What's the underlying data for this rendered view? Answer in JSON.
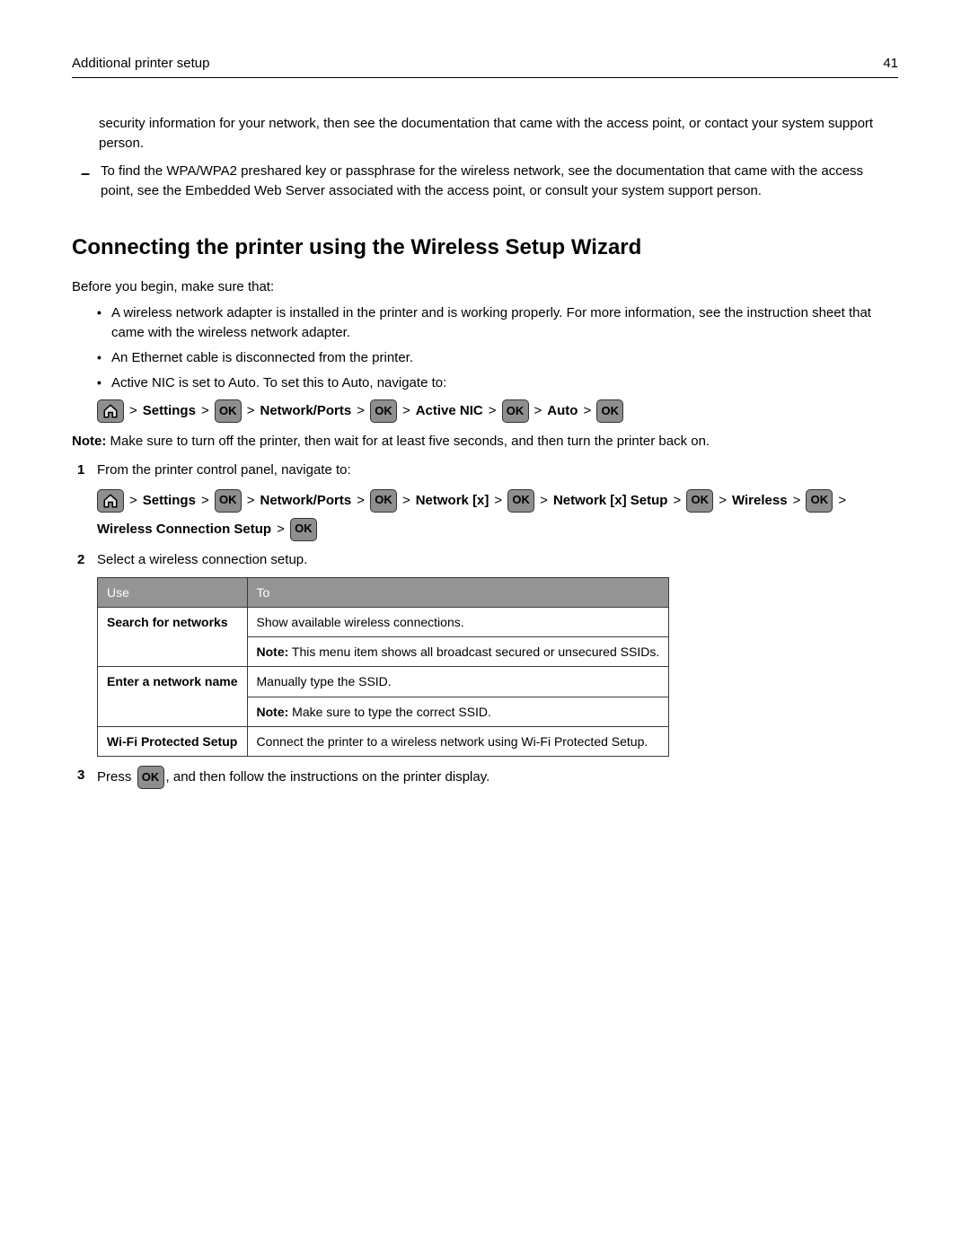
{
  "header": {
    "title": "Additional printer setup",
    "page": "41"
  },
  "continuation_para": "security information for your network, then see the documentation that came with the access point, or contact your system support person.",
  "dash_item": "To find the WPA/WPA2 preshared key or passphrase for the wireless network, see the documentation that came with the access point, see the Embedded Web Server associated with the access point, or consult your system support person.",
  "section_heading": "Connecting the printer using the Wireless Setup Wizard",
  "intro": "Before you begin, make sure that:",
  "bullets": {
    "b1": "A wireless network adapter is installed in the printer and is working properly. For more information, see the instruction sheet that came with the wireless network adapter.",
    "b2": "An Ethernet cable is disconnected from the printer.",
    "b3": "Active NIC is set to Auto. To set this to Auto, navigate to:"
  },
  "nav1": {
    "settings": "Settings",
    "network_ports": "Network/Ports",
    "active_nic": "Active NIC",
    "auto": "Auto",
    "ok": "OK"
  },
  "note_prefix": "Note:",
  "note_text": " Make sure to turn off the printer, then wait for at least five seconds, and then turn the printer back on.",
  "step1_text": "From the printer control panel, navigate to:",
  "nav2": {
    "settings": "Settings",
    "network_ports": "Network/Ports",
    "network_x": "Network [x]",
    "network_x_setup": "Network [x] Setup",
    "wireless": "Wireless",
    "wcs": "Wireless Connection Setup",
    "ok": "OK"
  },
  "step2_text": "Select a wireless connection setup.",
  "table": {
    "h1": "Use",
    "h2": "To",
    "r1c1": "Search for networks",
    "r1c2a": "Show available wireless connections.",
    "r1c2b_prefix": "Note:",
    "r1c2b": " This menu item shows all broadcast secured or unsecured SSIDs.",
    "r2c1": "Enter a network name",
    "r2c2a": "Manually type the SSID.",
    "r2c2b_prefix": "Note:",
    "r2c2b": " Make sure to type the correct SSID.",
    "r3c1": "Wi‑Fi Protected Setup",
    "r3c2": "Connect the printer to a wireless network using Wi‑Fi Protected Setup."
  },
  "step3_a": "Press ",
  "step3_b": ", and then follow the instructions on the printer display.",
  "ok_label": "OK"
}
